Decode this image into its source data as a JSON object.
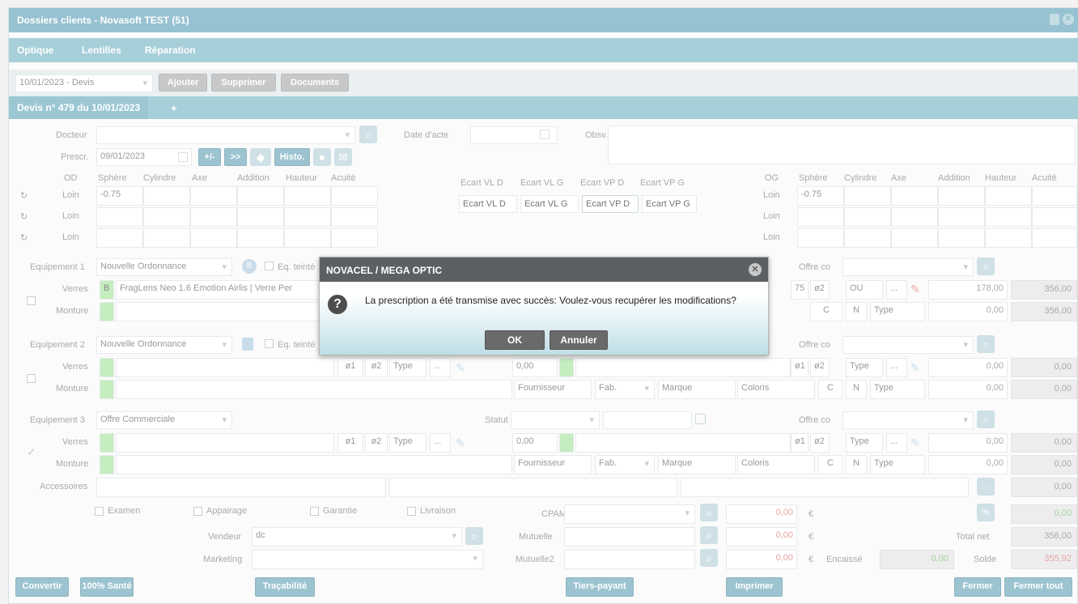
{
  "window": {
    "title": "Dossiers clients - Novasoft TEST (51)"
  },
  "tabs": [
    "Optique",
    "Lentilles",
    "Réparation"
  ],
  "toolbar": {
    "quote_select": "10/01/2023 - Devis",
    "add": "Ajouter",
    "delete": "Supprimer",
    "documents": "Documents"
  },
  "quote_tab": {
    "label": "Devis n° 479 du 10/01/2023",
    "plus": "+"
  },
  "prescription": {
    "docteur_label": "Docteur",
    "date_acte_label": "Date d'acte",
    "obsv_label": "Obsv.",
    "prescr_label": "Prescr.",
    "prescr_date": "09/01/2023",
    "btn_plusminus": "+/-",
    "btn_swap": ">>",
    "btn_histo": "Histo."
  },
  "od": {
    "headers": [
      "OD",
      "Sphère",
      "Cylindre",
      "Axe",
      "Addition",
      "Hauteur",
      "Acuité"
    ],
    "rows": [
      {
        "label": "Loin",
        "sphere": "-0.75"
      },
      {
        "label": "Loin",
        "sphere": ""
      },
      {
        "label": "Loin",
        "sphere": ""
      }
    ]
  },
  "ecart": {
    "headers": [
      "Ecart VL D",
      "Ecart VL G",
      "Ecart VP D",
      "Ecart VP G"
    ],
    "placeholders": [
      "Ecart VL D",
      "Ecart VL G",
      "Ecart VP D",
      "Ecart VP G"
    ]
  },
  "og": {
    "headers": [
      "OG",
      "Sphère",
      "Cylindre",
      "Axe",
      "Addition",
      "Hauteur",
      "Acuité"
    ],
    "rows": [
      {
        "label": "Loin",
        "sphere": "-0.75"
      },
      {
        "label": "Loin",
        "sphere": ""
      },
      {
        "label": "Loin",
        "sphere": ""
      }
    ]
  },
  "equip1": {
    "label": "Equipement 1",
    "type": "Nouvelle Ordonnance",
    "eq_teinte": "Eq. teinté",
    "offre_label": "Offre co",
    "verres_label": "Verres",
    "verres_code": "B",
    "verres_desc": "FragLens Neo 1.6 Emotion Airlis | Verre Per",
    "verres_d1": "75",
    "verres_o2": "ø2",
    "verres_type": "OU",
    "verres_more": "...",
    "verres_price": "178,00",
    "verres_total": "356,00",
    "monture_label": "Monture",
    "monture_c": "C",
    "monture_n": "N",
    "monture_type": "Type",
    "monture_price": "0,00",
    "monture_total": "356,00"
  },
  "equip2": {
    "label": "Equipement 2",
    "type": "Nouvelle Ordonnance",
    "eq_teinte": "Eq. teinté",
    "offre_label": "Offre co",
    "verres_label": "Verres",
    "o1": "ø1",
    "o2": "ø2",
    "type_ph": "Type",
    "more": "...",
    "verres_price_mid": "0,00",
    "verres_price": "0,00",
    "verres_total": "0,00",
    "monture_label": "Monture",
    "fournisseur": "Fournisseur",
    "fab": "Fab.",
    "marque": "Marque",
    "coloris": "Coloris",
    "c": "C",
    "n": "N",
    "monture_price": "0,00",
    "monture_total": "0,00"
  },
  "equip3": {
    "label": "Equipement 3",
    "type": "Offre Commerciale",
    "statut_label": "Statut",
    "offre_label": "Offre co",
    "verres_label": "Verres",
    "o1": "ø1",
    "o2": "ø2",
    "type_ph": "Type",
    "more": "...",
    "verres_price_mid": "0,00",
    "verres_price": "0,00",
    "verres_total": "0,00",
    "monture_label": "Monture",
    "fournisseur": "Fournisseur",
    "fab": "Fab.",
    "marque": "Marque",
    "coloris": "Coloris",
    "c": "C",
    "n": "N",
    "monture_price": "0,00",
    "monture_total": "0,00"
  },
  "accessoires": {
    "label": "Accessoires",
    "more": "...",
    "total": "0,00"
  },
  "checks": [
    "Examen",
    "Appairage",
    "Garantie",
    "Livraison"
  ],
  "payers": {
    "cpam_label": "CPAM",
    "cpam_amount": "0,00",
    "mutuelle_label": "Mutuelle",
    "mutuelle_amount": "0,00",
    "mutuelle2_label": "Mutuelle2",
    "mutuelle2_amount": "0,00",
    "currency": "€",
    "encaisse_label": "Encaissé",
    "encaisse_amount": "0,00"
  },
  "vendeur": {
    "label": "Vendeur",
    "value": "dc"
  },
  "marketing": {
    "label": "Marketing",
    "value": ""
  },
  "totals": {
    "pct_btn": "%",
    "pct_value": "0,00",
    "total_net_label": "Total net",
    "total_net": "356,00",
    "solde_label": "Solde",
    "solde": "355,92"
  },
  "bottom_buttons": {
    "convertir": "Convertir",
    "sante": "100% Santé",
    "tracabilite": "Traçabilité",
    "tiers": "Tiers-payant",
    "imprimer": "Imprimer",
    "fermer": "Fermer",
    "fermer_tout": "Fermer tout"
  },
  "modal": {
    "title": "NOVACEL / MEGA OPTIC",
    "message": "La prescription a été transmise avec succès: Voulez-vous recupérer les modifications?",
    "ok": "OK",
    "cancel": "Annuler"
  }
}
